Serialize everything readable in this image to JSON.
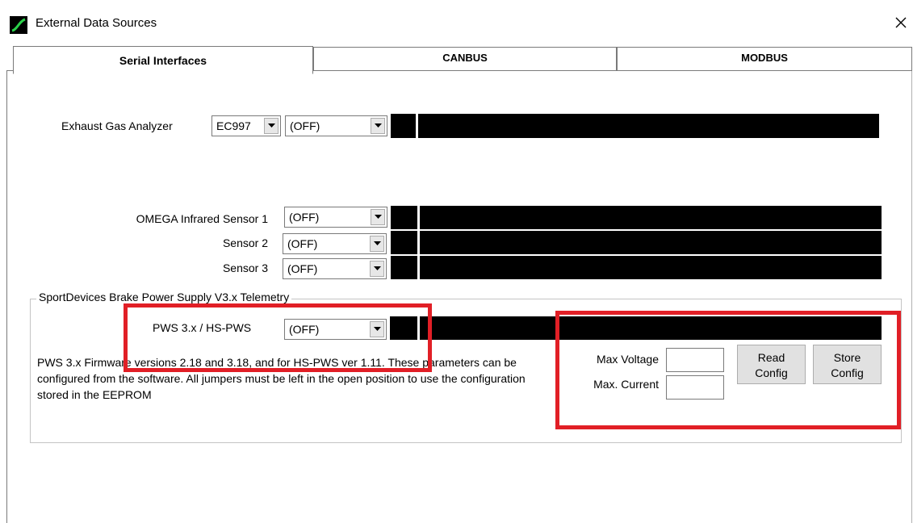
{
  "window": {
    "title": "External Data Sources"
  },
  "tabs": [
    {
      "label": "Serial Interfaces",
      "active": true
    },
    {
      "label": "CANBUS",
      "active": false
    },
    {
      "label": "MODBUS",
      "active": false
    }
  ],
  "exhaust": {
    "label": "Exhaust Gas Analyzer",
    "model": "EC997",
    "port": "(OFF)"
  },
  "omega": {
    "sensor1_label": "OMEGA Infrared Sensor 1",
    "sensor1_value": "(OFF)",
    "sensor2_label": "Sensor 2",
    "sensor2_value": "(OFF)",
    "sensor3_label": "Sensor 3",
    "sensor3_value": "(OFF)"
  },
  "brake": {
    "group_title": "SportDevices Brake Power Supply V3.x Telemetry",
    "pws_label": "PWS 3.x / HS-PWS",
    "pws_value": "(OFF)",
    "description": "PWS 3.x Firmware versions 2.18 and 3.18, and for HS-PWS ver 1.11. These parameters can be configured from the software. All jumpers must be left in the open position to use the configuration stored in the EEPROM",
    "max_voltage_label": "Max Voltage",
    "max_voltage_value": "",
    "max_current_label": "Max. Current",
    "max_current_value": "",
    "read_config_label_1": "Read",
    "read_config_label_2": "Config",
    "store_config_label_1": "Store",
    "store_config_label_2": "Config"
  },
  "colors": {
    "highlight": "#e11f26",
    "status_bar": "#000000",
    "accent_icon": "#1a8c2e"
  },
  "icons": {
    "app": "graph-curve-icon",
    "close": "close-icon",
    "dropdown": "chevron-down-icon"
  }
}
